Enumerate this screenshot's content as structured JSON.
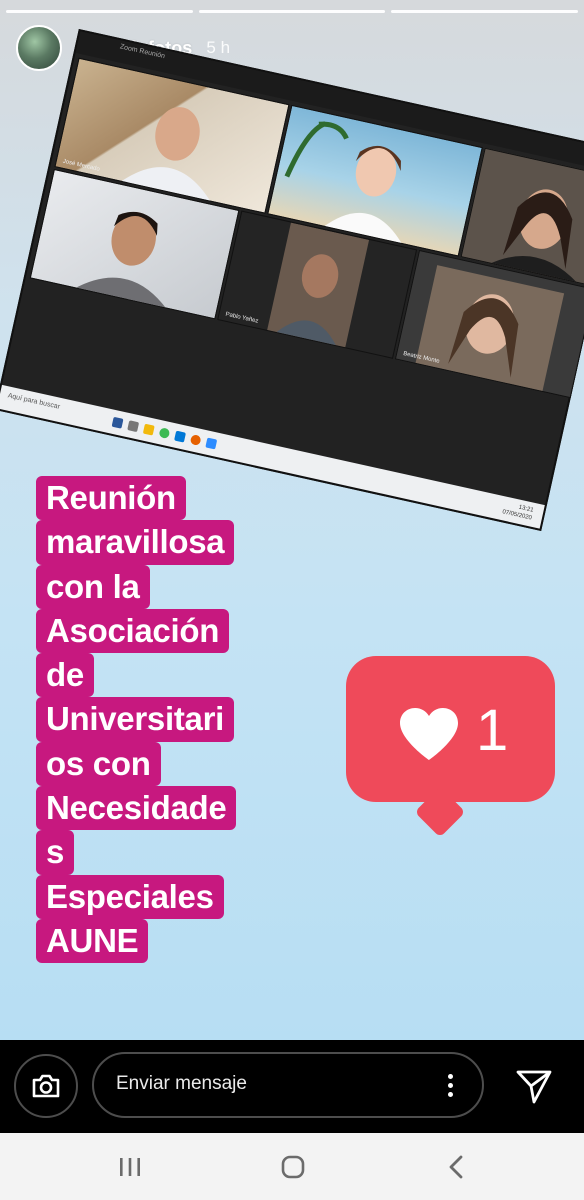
{
  "story": {
    "progress_segments": 3,
    "username": "joselillofotos",
    "time": "5 h",
    "screenshot": {
      "window_title": "Zoom Reunión",
      "participants": [
        "José Mercado",
        "",
        "",
        "Pablo Yañez",
        "Beatriz Monte"
      ],
      "taskbar_search": "Aquí para buscar",
      "clock_time": "13:21",
      "clock_date": "07/05/2020"
    },
    "caption_lines": [
      "Reunión",
      "maravillosa",
      "con la",
      "Asociación",
      "de",
      "Universitari",
      "os con",
      "Necesidade",
      "s",
      "Especiales",
      "AUNE"
    ],
    "like_sticker": {
      "count": "1",
      "icon": "heart-icon"
    }
  },
  "message_bar": {
    "placeholder": "Enviar mensaje",
    "camera_icon": "camera-icon",
    "more_icon": "more-vertical-icon",
    "send_icon": "send-icon"
  },
  "system_nav": {
    "recents_icon": "recents-icon",
    "home_icon": "home-icon",
    "back_icon": "back-icon"
  },
  "colors": {
    "caption_bg": "#c7187f",
    "like_bg": "#ef4a5a"
  }
}
